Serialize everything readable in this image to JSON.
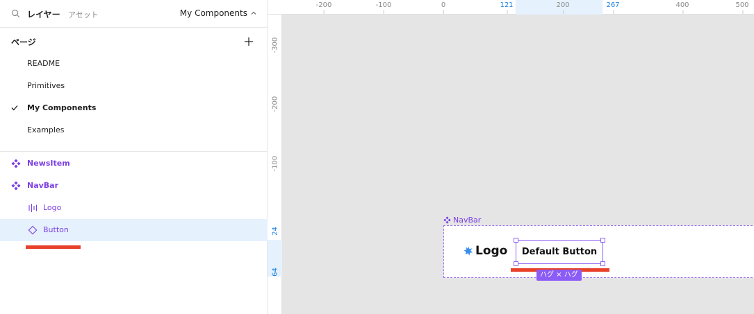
{
  "header": {
    "tab_layers": "レイヤー",
    "tab_assets": "アセット",
    "current_page": "My Components"
  },
  "pages": {
    "title": "ページ",
    "items": [
      {
        "label": "README",
        "selected": false
      },
      {
        "label": "Primitives",
        "selected": false
      },
      {
        "label": "My Components",
        "selected": true
      },
      {
        "label": "Examples",
        "selected": false
      }
    ]
  },
  "layers": [
    {
      "label": "NewsItem",
      "type": "component",
      "icon": "component-icon"
    },
    {
      "label": "NavBar",
      "type": "component",
      "icon": "component-icon"
    },
    {
      "label": "Logo",
      "type": "child",
      "icon": "auto-layout-icon"
    },
    {
      "label": "Button",
      "type": "instance",
      "icon": "instance-icon",
      "selected": true
    }
  ],
  "ruler": {
    "x_ticks": [
      "-200",
      "-100",
      "0",
      "121",
      "200",
      "267",
      "400",
      "500"
    ],
    "y_ticks": [
      "-300",
      "-200",
      "-100",
      "24",
      "64"
    ]
  },
  "canvas": {
    "frame_name": "NavBar",
    "logo_text": "Logo",
    "button_text": "Default Button",
    "hug_badge": "ハグ × ハグ"
  },
  "colors": {
    "component": "#7b3fe4",
    "selection": "#8b5cf6",
    "ruler_highlight": "#1b7fe0",
    "annotation": "#e8412a",
    "logo_star": "#3b8ef0"
  }
}
